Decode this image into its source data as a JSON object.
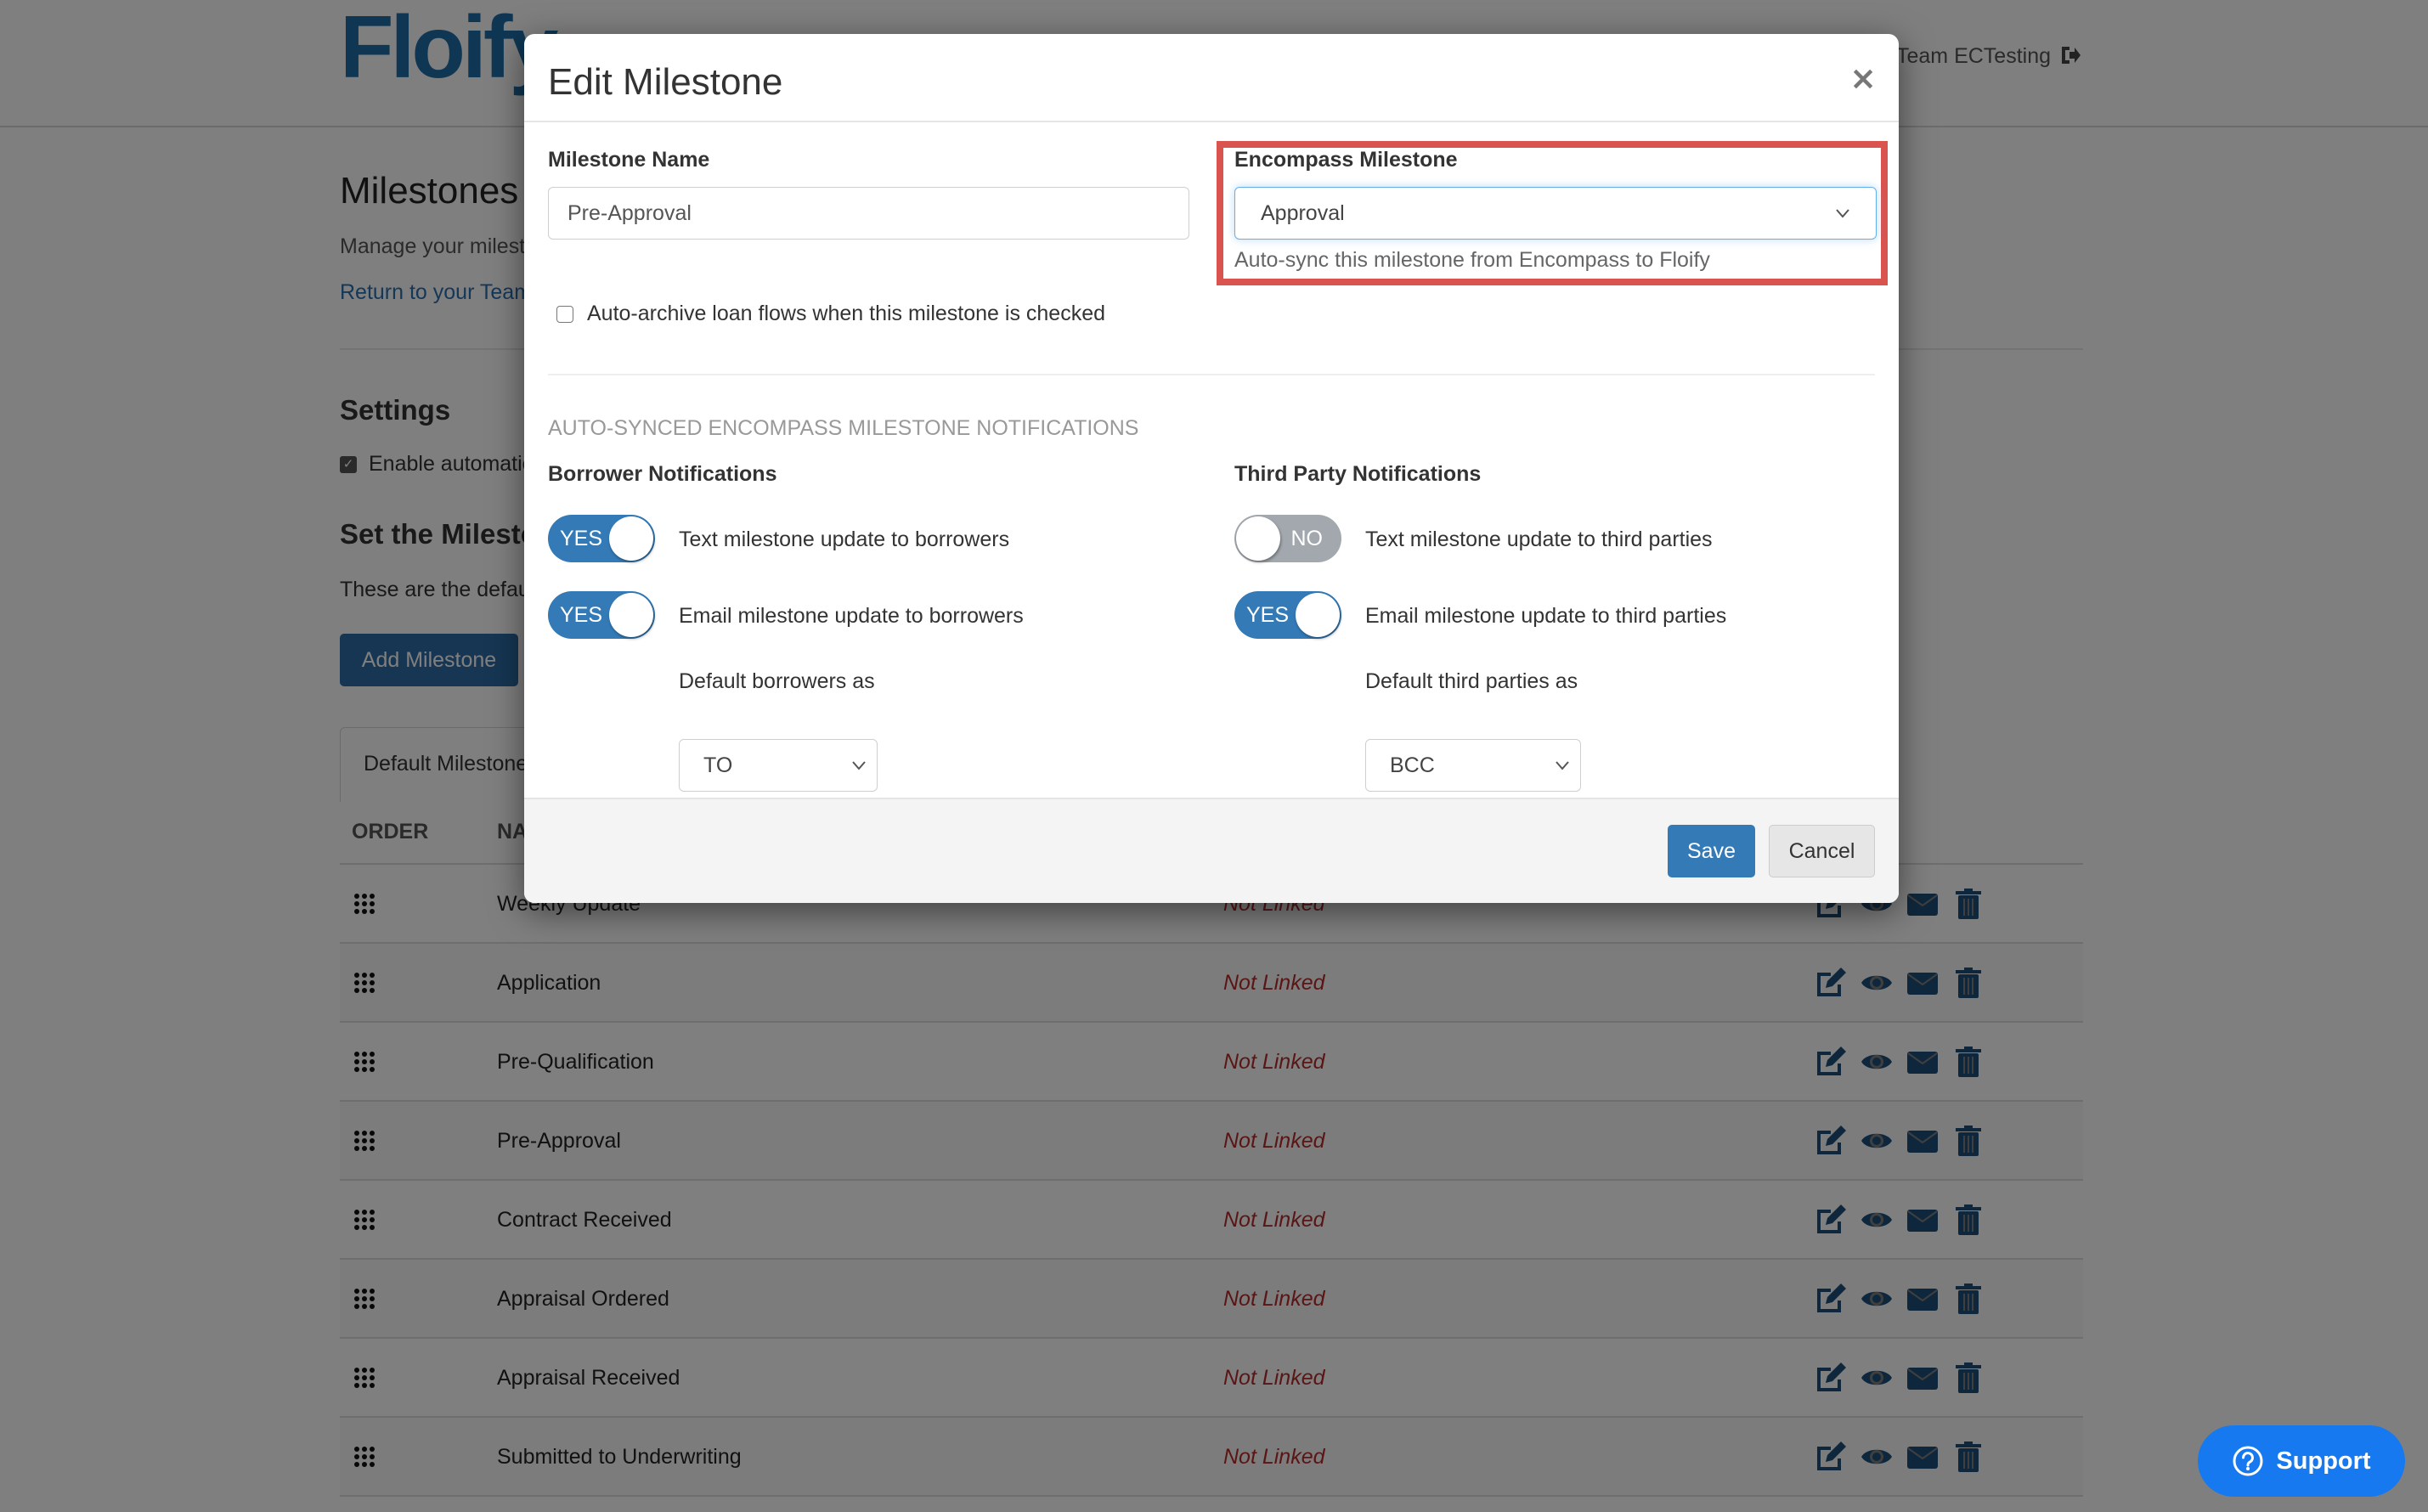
{
  "header": {
    "logo_text": "Floify",
    "team_link": "Team ECTesting",
    "logout_icon": "sign-out-icon"
  },
  "page": {
    "title": "Milestones",
    "subtitle": "Manage your milestones",
    "return_link": "Return to your Team",
    "settings_heading": "Settings",
    "enable_label": "Enable automatic milestone updates",
    "enable_checked": true,
    "set_heading": "Set the Milestones",
    "set_description": "These are the default milestones",
    "add_button": "Add Milestone",
    "tab_label": "Default Milestones",
    "table": {
      "columns": [
        "ORDER",
        "NAME"
      ],
      "rows": [
        {
          "name": "Weekly Update",
          "link_status": "Not Linked"
        },
        {
          "name": "Application",
          "link_status": "Not Linked"
        },
        {
          "name": "Pre-Qualification",
          "link_status": "Not Linked"
        },
        {
          "name": "Pre-Approval",
          "link_status": "Not Linked"
        },
        {
          "name": "Contract Received",
          "link_status": "Not Linked"
        },
        {
          "name": "Appraisal Ordered",
          "link_status": "Not Linked"
        },
        {
          "name": "Appraisal Received",
          "link_status": "Not Linked"
        },
        {
          "name": "Submitted to Underwriting",
          "link_status": "Not Linked"
        }
      ],
      "row_action_icons": [
        "edit-icon",
        "eye-icon",
        "envelope-icon",
        "trash-icon"
      ]
    },
    "support_button": "Support"
  },
  "modal": {
    "title": "Edit Milestone",
    "close_symbol": "×",
    "milestone_name_label": "Milestone Name",
    "milestone_name_value": "Pre-Approval",
    "encompass_label": "Encompass Milestone",
    "encompass_selected": "Approval",
    "encompass_help": "Auto-sync this milestone from Encompass to Floify",
    "auto_archive_label": "Auto-archive loan flows when this milestone is checked",
    "auto_archive_checked": false,
    "notifications_heading": "AUTO-SYNCED ENCOMPASS MILESTONE NOTIFICATIONS",
    "borrower": {
      "heading": "Borrower Notifications",
      "text_toggle": {
        "state": "YES",
        "label": "Text milestone update to borrowers"
      },
      "email_toggle": {
        "state": "YES",
        "label": "Email milestone update to borrowers"
      },
      "default_label": "Default borrowers as",
      "default_value": "TO"
    },
    "third_party": {
      "heading": "Third Party Notifications",
      "text_toggle": {
        "state": "NO",
        "label": "Text milestone update to third parties"
      },
      "email_toggle": {
        "state": "YES",
        "label": "Email milestone update to third parties"
      },
      "default_label": "Default third parties as",
      "default_value": "BCC"
    },
    "save_button": "Save",
    "cancel_button": "Cancel"
  },
  "colors": {
    "primary": "#337ab7",
    "highlight_border": "#d9534f",
    "not_linked": "#b52b2b",
    "support": "#1779f0"
  }
}
